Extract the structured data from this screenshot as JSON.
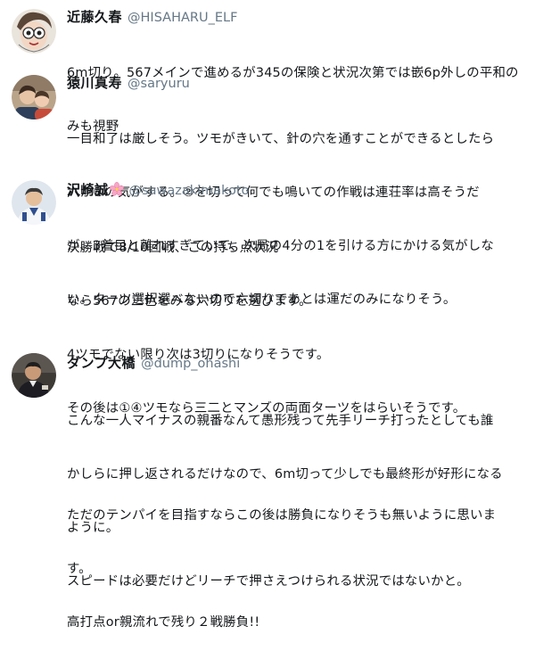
{
  "tweets": [
    {
      "name": "近藤久春",
      "handle": "@HISAHARU_ELF",
      "avatar_icon": "cartoon-face-avatar",
      "lines": [
        "6m切り。567メインで進めるが345の保険と状況次第では嵌6p外しの平和の",
        "みも視野"
      ]
    },
    {
      "name": "猿川真寿",
      "handle": "@saryuru",
      "avatar_icon": "two-people-photo-avatar",
      "lines": [
        "一目和了は厳しそう。ツモがきいて、針の穴を通すことができるとしたら",
        "六か⑦の気がする。②を切って何でも鳴いての作戦は連荘率は高そうだ",
        "が、3着目と離れすぎていて、次局の4分の1を引ける方にかける気がしな",
        "い。ターツ選択選べないので六切りであとは運だのみになりそう。"
      ]
    },
    {
      "name": "沢崎誠",
      "handle": "@sawazakimakoto",
      "avatar_icon": "man-in-uniform-avatar",
      "name_emoji": "cherry-blossom-icon",
      "lines": [
        "決勝戦で8/10回戦、この持ち点状況",
        "なら567の三色をみる六切りを選びます。",
        "4ツモでない限り次は3切りになりそうです。",
        "その後は①④ツモなら三二とマンズの両面ターツをはらいそうです。",
        "",
        "ただのテンパイを目指すならこの後は勝負になりそうも無いように思いま",
        "す。",
        "高打点or親流れで残り２戦勝負!!"
      ]
    },
    {
      "name": "ダンプ大橋",
      "handle": "@dump_ohashi",
      "avatar_icon": "man-in-suit-avatar",
      "lines": [
        "こんな一人マイナスの親番なんて愚形残って先手リーチ打ったとしても誰",
        "かしらに押し返されるだけなので、6m切って少しでも最終形が好形になる",
        "ように。",
        "スピードは必要だけどリーチで押さえつけられる状況ではないかと。"
      ]
    }
  ],
  "colors": {
    "name": "#14171a",
    "handle": "#657786",
    "text": "#14171a",
    "background": "#ffffff"
  }
}
